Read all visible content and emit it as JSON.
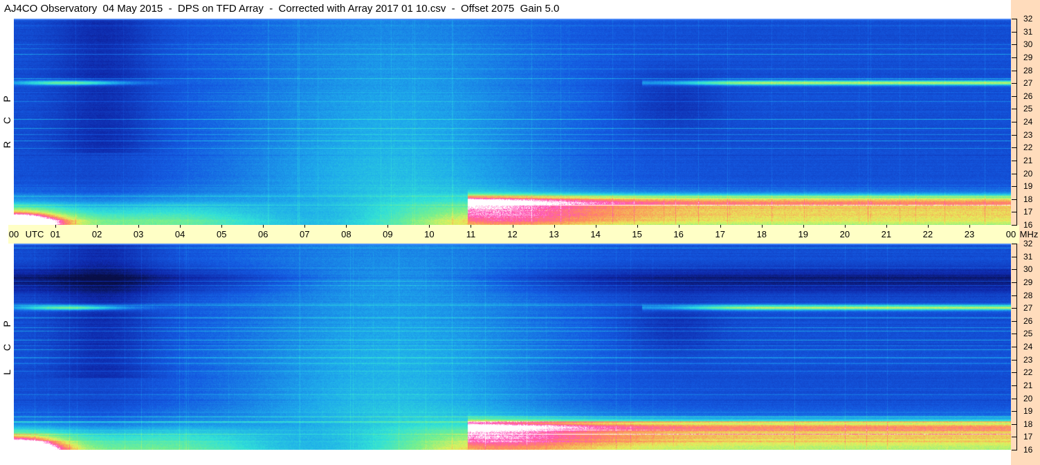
{
  "title": "AJ4CO Observatory  04 May 2015  -  DPS on TFD Array  -  Corrected with Array 2017 01 10.csv  -  Offset 2075  Gain 5.0",
  "panels": [
    {
      "id": "rcp",
      "label_letters": [
        "R",
        "C",
        "P"
      ]
    },
    {
      "id": "lcp",
      "label_letters": [
        "L",
        "C",
        "P"
      ]
    }
  ],
  "time_axis": {
    "start_label": "00",
    "utc_label": "UTC",
    "hours": [
      "01",
      "02",
      "03",
      "04",
      "05",
      "06",
      "07",
      "08",
      "09",
      "10",
      "11",
      "12",
      "13",
      "14",
      "15",
      "16",
      "17",
      "18",
      "19",
      "20",
      "21",
      "22",
      "23"
    ],
    "end_label": "00",
    "unit": "MHz"
  },
  "chart_data": {
    "type": "heatmap",
    "x_label": "UTC",
    "x_range": [
      0,
      24
    ],
    "y_unit": "MHz",
    "y_range": [
      16,
      32
    ],
    "y_ticks": [
      16,
      17,
      18,
      19,
      20,
      21,
      22,
      23,
      24,
      25,
      26,
      27,
      28,
      29,
      30,
      31,
      32
    ],
    "panels": [
      "RCP",
      "LCP"
    ],
    "colors": {
      "low": "#0a1a5c",
      "mid_low": "#1458d8",
      "mid": "#2ad8e0",
      "mid_high": "#b8f060",
      "high": "#ff5ab8",
      "peak": "#ffffff"
    }
  }
}
